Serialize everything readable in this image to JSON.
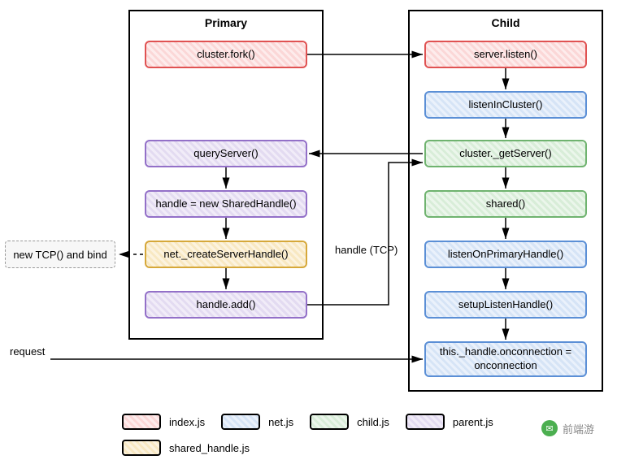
{
  "columns": {
    "primary": {
      "title": "Primary"
    },
    "child": {
      "title": "Child"
    }
  },
  "primary_nodes": {
    "fork": "cluster.fork()",
    "queryServer": "queryServer()",
    "newSharedHandle": "handle = new SharedHandle()",
    "createServerHandle": "net._createServerHandle()",
    "handleAdd": "handle.add()"
  },
  "child_nodes": {
    "serverListen": "server.listen()",
    "listenInCluster": "listenInCluster()",
    "getServer": "cluster._getServer()",
    "shared": "shared()",
    "listenOnPrimaryHandle": "listenOnPrimaryHandle()",
    "setupListenHandle": "setupListenHandle()",
    "onconnection": "this._handle.onconnection = onconnection"
  },
  "notes": {
    "newTcp": "new TCP() and bind"
  },
  "edge_labels": {
    "handleTcp": "handle (TCP)",
    "request": "request"
  },
  "legend": {
    "index": "index.js",
    "net": "net.js",
    "child": "child.js",
    "parent": "parent.js",
    "shared_handle": "shared_handle.js"
  },
  "watermark": "前端游"
}
